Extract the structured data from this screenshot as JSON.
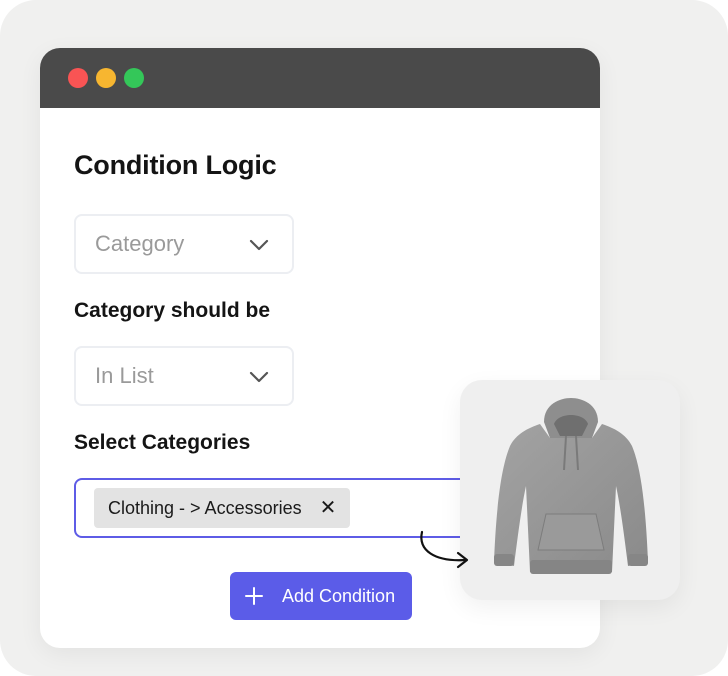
{
  "window": {
    "controls": [
      "close",
      "minimize",
      "maximize"
    ],
    "colors": {
      "close": "#f95454",
      "minimize": "#f7b630",
      "maximize": "#34c759",
      "titlebar": "#4a4a4a"
    }
  },
  "form": {
    "title": "Condition Logic",
    "condition_select": {
      "value": "Category",
      "icon": "chevron-down-icon"
    },
    "category_label": "Category should be",
    "operator_select": {
      "value": "In List",
      "icon": "chevron-down-icon"
    },
    "categories_label": "Select Categories",
    "selected_categories": [
      {
        "label": "Clothing - > Accessories",
        "remove_icon": "close-icon",
        "remove_glyph": "✕"
      }
    ],
    "add_button": {
      "label": "Add Condition",
      "icon": "plus-icon"
    },
    "accent_color": "#5b5ce8"
  },
  "preview": {
    "image": "hoodie",
    "pointer_icon": "curved-arrow-icon"
  }
}
